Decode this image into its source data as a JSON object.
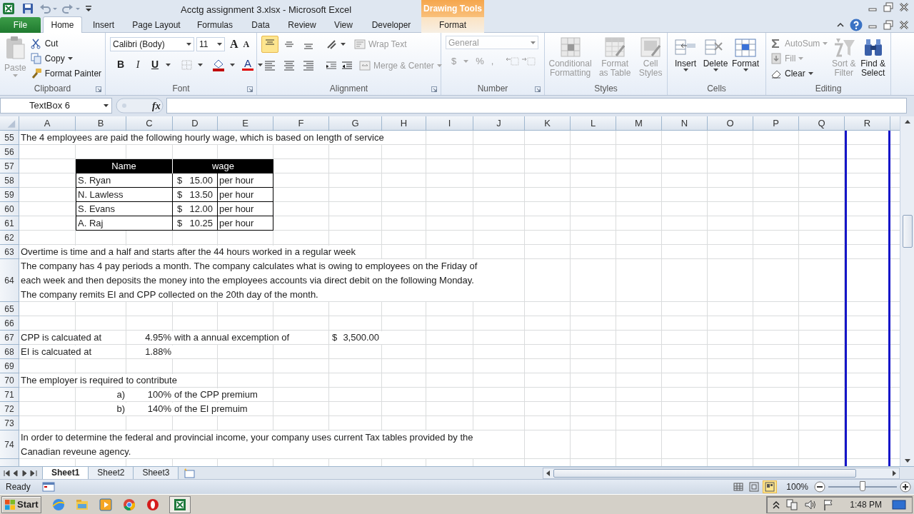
{
  "title_bar": {
    "title": "Acctg assignment 3.xlsx  -  Microsoft Excel",
    "context_group": "Drawing Tools"
  },
  "ribbon_tabs": [
    {
      "label": "File",
      "kind": "file",
      "selected": false
    },
    {
      "label": "Home",
      "kind": "tab",
      "selected": true
    },
    {
      "label": "Insert",
      "kind": "tab",
      "selected": false
    },
    {
      "label": "Page Layout",
      "kind": "tab",
      "selected": false
    },
    {
      "label": "Formulas",
      "kind": "tab",
      "selected": false
    },
    {
      "label": "Data",
      "kind": "tab",
      "selected": false
    },
    {
      "label": "Review",
      "kind": "tab",
      "selected": false
    },
    {
      "label": "View",
      "kind": "tab",
      "selected": false
    },
    {
      "label": "Developer",
      "kind": "tab",
      "selected": false
    },
    {
      "label": "Format",
      "kind": "contextual",
      "selected": false
    }
  ],
  "ribbon_groups": [
    {
      "kind": "clipboard",
      "label": "Clipboard",
      "paste": {
        "label": "Paste",
        "disabled": true
      },
      "commands": [
        {
          "label": "Cut",
          "disabled": false
        },
        {
          "label": "Copy",
          "disabled": false
        },
        {
          "label": "Format Painter",
          "disabled": false
        }
      ]
    },
    {
      "kind": "font",
      "label": "Font",
      "font_name": "Calibri (Body)",
      "font_size": "11",
      "size_buttons": [
        "A",
        "A"
      ],
      "style_buttons": [
        "B",
        "I",
        "U"
      ],
      "font_color_label": "A"
    },
    {
      "kind": "alignment",
      "label": "Alignment",
      "vertical_align": [
        {
          "selected": true
        },
        {
          "selected": false
        },
        {
          "selected": false
        }
      ],
      "horizontal_align": [
        {
          "selected": false
        },
        {
          "selected": false
        },
        {
          "selected": false
        }
      ],
      "commands": [
        {
          "label": "Wrap Text",
          "disabled": true
        },
        {
          "label": "Merge & Center",
          "disabled": true
        }
      ]
    },
    {
      "kind": "number",
      "label": "Number",
      "number_format": "General",
      "symbols": [
        "$",
        "%",
        ","
      ],
      "disabled": true
    },
    {
      "kind": "styles",
      "label": "Styles",
      "commands": [
        {
          "lines": [
            "Conditional",
            "Formatting"
          ],
          "disabled": true
        },
        {
          "lines": [
            "Format",
            "as Table"
          ],
          "disabled": true
        },
        {
          "lines": [
            "Cell",
            "Styles"
          ],
          "disabled": true
        }
      ]
    },
    {
      "kind": "cells",
      "label": "Cells",
      "commands": [
        {
          "lines": [
            "Insert"
          ],
          "disabled": false
        },
        {
          "lines": [
            "Delete"
          ],
          "disabled": false
        },
        {
          "lines": [
            "Format"
          ],
          "disabled": false
        }
      ]
    },
    {
      "kind": "editing",
      "label": "Editing",
      "commands": [
        {
          "label": "AutoSum",
          "disabled": true
        },
        {
          "label": "Fill",
          "disabled": true
        },
        {
          "label": "Clear",
          "disabled": false
        }
      ],
      "big_commands": [
        {
          "lines": [
            "Sort &",
            "Filter"
          ],
          "disabled": true
        },
        {
          "lines": [
            "Find &",
            "Select"
          ],
          "disabled": false
        }
      ]
    }
  ],
  "formula_bar": {
    "name_box": "TextBox 6",
    "function_label": "fx"
  },
  "columns": [
    "A",
    "B",
    "C",
    "D",
    "E",
    "F",
    "G",
    "H",
    "I",
    "J",
    "K",
    "L",
    "M",
    "N",
    "O",
    "P",
    "Q",
    "R"
  ],
  "rows": [
    {
      "number": "55",
      "kind": "grid",
      "cells": [
        {
          "kind": "text",
          "text": "The 4 employees are paid the following hourly wage, which is based on length of service"
        }
      ]
    },
    {
      "number": "56",
      "kind": "grid"
    },
    {
      "number": "57",
      "kind": "table_head",
      "headers": [
        "Name",
        "wage"
      ]
    },
    {
      "number": "58",
      "kind": "table_row",
      "name": "S. Ryan",
      "currency": "$",
      "amount": "15.00",
      "unit": "per hour"
    },
    {
      "number": "59",
      "kind": "table_row",
      "name": "N. Lawless",
      "currency": "$",
      "amount": "13.50",
      "unit": "per hour"
    },
    {
      "number": "60",
      "kind": "table_row",
      "name": "S. Evans",
      "currency": "$",
      "amount": "12.00",
      "unit": "per hour"
    },
    {
      "number": "61",
      "kind": "table_row",
      "name": "A. Raj",
      "currency": "$",
      "amount": "10.25",
      "unit": "per hour"
    },
    {
      "number": "62",
      "kind": "grid"
    },
    {
      "number": "63",
      "kind": "grid",
      "cells": [
        {
          "kind": "text",
          "text": "Overtime is time and a half and starts after the 44 hours worked in a regular week"
        }
      ]
    },
    {
      "number": "64",
      "kind": "wrap",
      "lines": [
        "The company has 4 pay periods a month. The company calculates what is owing to employees on the Friday of",
        "each week and then deposits the money into the employees accounts via direct debit on the following Monday.",
        "The company remits EI and CPP collected on the 20th day of the month."
      ]
    },
    {
      "number": "65",
      "kind": "grid"
    },
    {
      "number": "66",
      "kind": "grid"
    },
    {
      "number": "67",
      "kind": "grid",
      "cells": [
        {
          "kind": "text",
          "text": "CPP is calcuated at"
        },
        null,
        {
          "kind": "number",
          "text": "4.95%"
        },
        {
          "kind": "text",
          "text": "with a annual excemption of"
        },
        null,
        null,
        {
          "kind": "currency",
          "currency": "$",
          "text": "3,500.00"
        }
      ]
    },
    {
      "number": "68",
      "kind": "grid",
      "cells": [
        {
          "kind": "text",
          "text": "EI is calcuated at"
        },
        null,
        {
          "kind": "number",
          "text": "1.88%"
        }
      ]
    },
    {
      "number": "69",
      "kind": "grid"
    },
    {
      "number": "70",
      "kind": "grid",
      "cells": [
        {
          "kind": "text",
          "text": "The employer is required to contribute"
        }
      ]
    },
    {
      "number": "71",
      "kind": "grid",
      "cells": [
        null,
        {
          "kind": "number",
          "text": "a)"
        },
        {
          "kind": "number",
          "text": "100%"
        },
        {
          "kind": "text",
          "text": "of the CPP premium"
        }
      ]
    },
    {
      "number": "72",
      "kind": "grid",
      "cells": [
        null,
        {
          "kind": "number",
          "text": "b)"
        },
        {
          "kind": "number",
          "text": "140%"
        },
        {
          "kind": "text",
          "text": "of the EI premuim"
        }
      ]
    },
    {
      "number": "73",
      "kind": "grid"
    },
    {
      "number": "74",
      "kind": "wrap",
      "lines": [
        "In order to determine the federal and provincial income, your company uses current Tax tables provided by the",
        "Canadian reveune agency."
      ]
    }
  ],
  "sheet_tabs": [
    {
      "label": "Sheet1",
      "selected": true
    },
    {
      "label": "Sheet2",
      "selected": false
    },
    {
      "label": "Sheet3",
      "selected": false
    }
  ],
  "status_bar": {
    "status": "Ready",
    "views": [
      {
        "selected": false
      },
      {
        "selected": false
      },
      {
        "selected": true
      }
    ],
    "zoom": "100%",
    "zoom_slider": {
      "level": 0.5
    }
  },
  "taskbar": {
    "start": "Start",
    "time": "1:48 PM"
  }
}
